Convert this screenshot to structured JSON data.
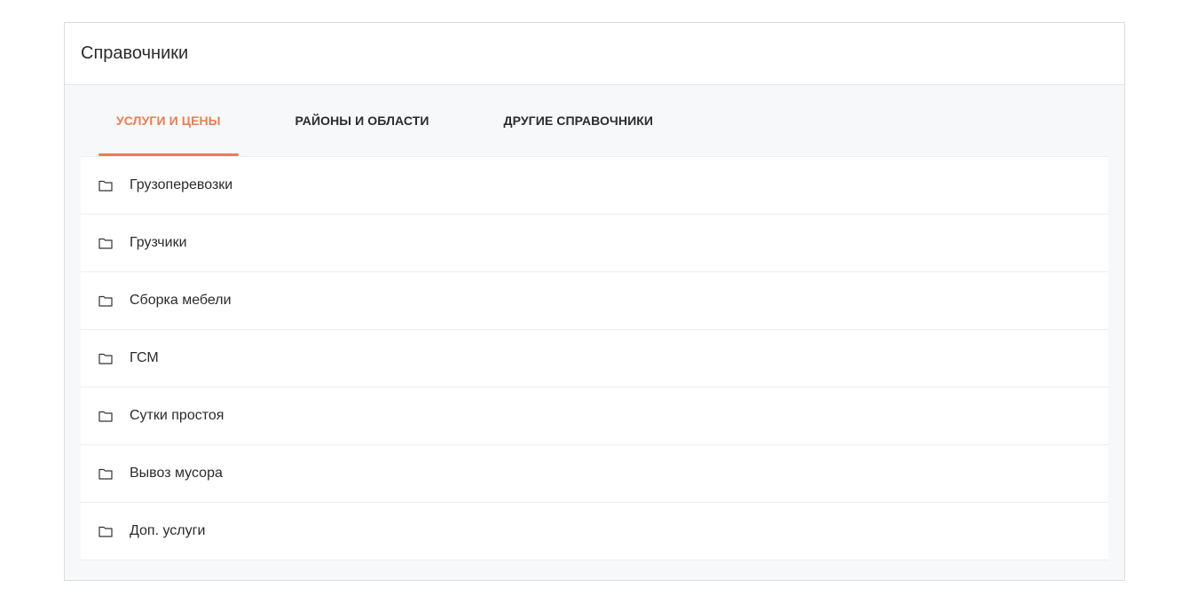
{
  "header": {
    "title": "Справочники"
  },
  "tabs": [
    {
      "label": "Услуги и цены",
      "active": true
    },
    {
      "label": "Районы и области",
      "active": false
    },
    {
      "label": "Другие справочники",
      "active": false
    }
  ],
  "list": {
    "icon": "folder-icon",
    "items": [
      {
        "label": "Грузоперевозки"
      },
      {
        "label": "Грузчики"
      },
      {
        "label": "Сборка мебели"
      },
      {
        "label": "ГСМ"
      },
      {
        "label": "Сутки простоя"
      },
      {
        "label": "Вывоз мусора"
      },
      {
        "label": "Доп. услуги"
      }
    ]
  },
  "colors": {
    "accent": "#f07b4d",
    "text": "#2b2b2b",
    "panel_bg": "#f7f8fa"
  }
}
